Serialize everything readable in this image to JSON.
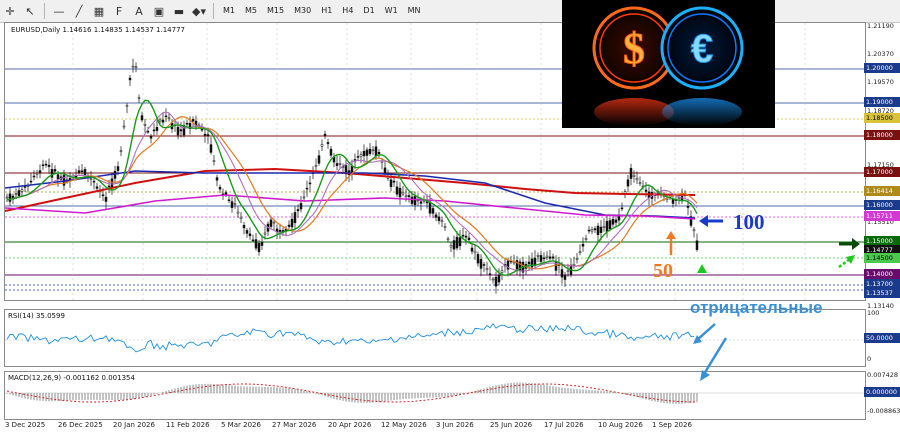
{
  "toolbar": {
    "icons": [
      "crosshair-icon",
      "cursor-icon",
      "line-icon",
      "trendline-icon",
      "channel-icon",
      "text-icon",
      "fibonacci-icon",
      "rectangle-icon",
      "ellipse-icon",
      "arrow-icon"
    ],
    "timeframes": [
      "M1",
      "M5",
      "M15",
      "M30",
      "H1",
      "H4",
      "D1",
      "W1",
      "MN"
    ]
  },
  "chart": {
    "header": "EURUSD,Daily  1.14616 1.14835 1.14537 1.14777",
    "rsi_label": "RSI(14) 35.0599",
    "macd_label": "MACD(12,26,9) -0.001162 0.001354"
  },
  "price_axis": {
    "ticks": [
      "1.21190",
      "1.20370",
      "1.19570",
      "1.18720",
      "1.17150",
      "1.15510",
      "1.13140"
    ],
    "labels": [
      {
        "text": "1.20000",
        "bg": "#1a3a8c"
      },
      {
        "text": "1.19000",
        "bg": "#1a3a8c"
      },
      {
        "text": "1.18500",
        "bg": "#d8c23a"
      },
      {
        "text": "1.18000",
        "bg": "#7a1010"
      },
      {
        "text": "1.17000",
        "bg": "#7a1010"
      },
      {
        "text": "1.16414",
        "bg": "#b08a1a"
      },
      {
        "text": "1.16000",
        "bg": "#1a3a8c"
      },
      {
        "text": "1.15711",
        "bg": "#d23ad2"
      },
      {
        "text": "1.15000",
        "bg": "#0a6a0a"
      },
      {
        "text": "1.14777",
        "bg": "#111111"
      },
      {
        "text": "1.14500",
        "bg": "#4cc84c"
      },
      {
        "text": "1.14000",
        "bg": "#6a0a6a"
      },
      {
        "text": "1.13700",
        "bg": "#1a3a8c"
      },
      {
        "text": "1.13537",
        "bg": "#1a3a8c"
      }
    ]
  },
  "rsi_axis": {
    "ticks": [
      "100",
      "50.0000",
      "0"
    ]
  },
  "macd_axis": {
    "ticks": [
      "0.007428",
      "0.000000",
      "-0.008863"
    ]
  },
  "dates": [
    "3 Dec 2025",
    "26 Dec 2025",
    "20 Jan 2026",
    "11 Feb 2026",
    "5 Mar 2026",
    "27 Mar 2026",
    "20 Apr 2026",
    "12 May 2026",
    "3 Jun 2026",
    "25 Jun 2026",
    "17 Jul 2026",
    "10 Aug 2026",
    "1 Sep 2026"
  ],
  "annotations": {
    "ma100": "100",
    "ma50": "50",
    "negative": "отрицательные"
  },
  "colors": {
    "blue_annotation": "#1a3acb",
    "orange_annotation": "#f07a20",
    "negative_text": "#3a8fd8",
    "green_arrow": "#1ec81e"
  }
}
